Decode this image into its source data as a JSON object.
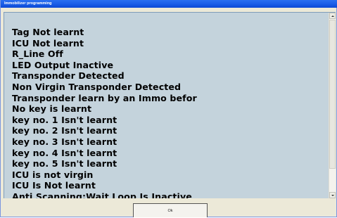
{
  "window": {
    "title": "Immobilizer programming"
  },
  "list": {
    "lines": [
      "Tag Not learnt",
      "ICU Not learnt",
      "R_Line Off",
      "LED Output Inactive",
      "Transponder Detected",
      "Non Virgin Transponder Detected",
      "Transponder learn by an Immo befor",
      "No key is learnt",
      "key no. 1 Isn't learnt",
      "key no. 2 Isn't learnt",
      "key no. 3 Isn't learnt",
      "key no. 4 Isn't learnt",
      "key no. 5 Isn't learnt",
      "ICU is not virgin",
      "ICU Is Not learnt",
      "Anti Scanning:Wait Loop Is Inactive"
    ]
  },
  "buttons": {
    "ok_label": "Ok"
  },
  "colors": {
    "titlebar": "#0b49d4",
    "list_background": "#c4d3dc",
    "dialog_background": "#ece9d8"
  }
}
